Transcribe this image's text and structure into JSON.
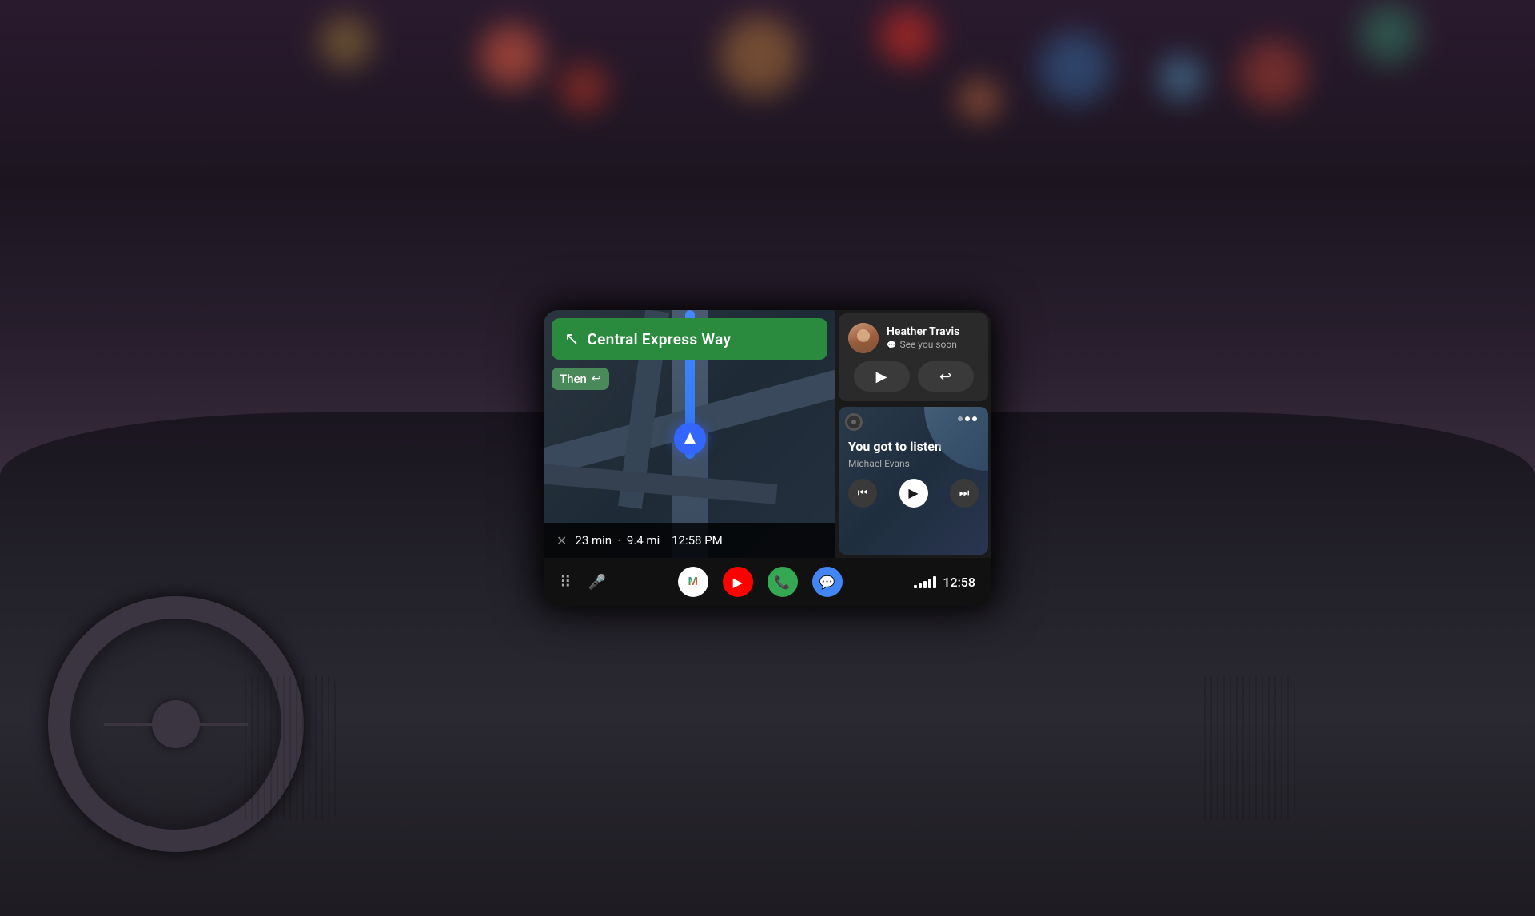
{
  "scene": {
    "bg_colors": [
      "#2a1a2e",
      "#3a2535",
      "#4a3550"
    ],
    "time": "Evening/night with city bokeh"
  },
  "navigation": {
    "street_name": "Central Express Way",
    "turn_arrow": "↖",
    "then_label": "Then",
    "then_arrow": "↩",
    "eta_minutes": "23 min",
    "eta_distance": "9.4 mi",
    "eta_time": "12:58 PM",
    "close_icon": "✕"
  },
  "notification": {
    "contact_name": "Heather Travis",
    "message": "See you soon",
    "message_icon": "💬",
    "play_label": "▶",
    "reply_label": "↩"
  },
  "music": {
    "title": "You got to listen",
    "artist": "Michael Evans",
    "prev_icon": "⏮",
    "play_icon": "▶",
    "next_icon": "⏭",
    "dots": [
      false,
      true,
      true
    ]
  },
  "navbar": {
    "grid_icon": "⠿",
    "mic_icon": "🎤",
    "apps": [
      {
        "name": "Google Maps",
        "label": "M",
        "bg": "#ffffff"
      },
      {
        "name": "YouTube",
        "label": "▶",
        "bg": "#ff0000"
      },
      {
        "name": "Phone",
        "label": "📞",
        "bg": "#34a853"
      },
      {
        "name": "Messages",
        "label": "💬",
        "bg": "#4285f4"
      }
    ],
    "signal_bars": [
      4,
      6,
      9,
      12,
      15
    ],
    "time": "12:58"
  }
}
